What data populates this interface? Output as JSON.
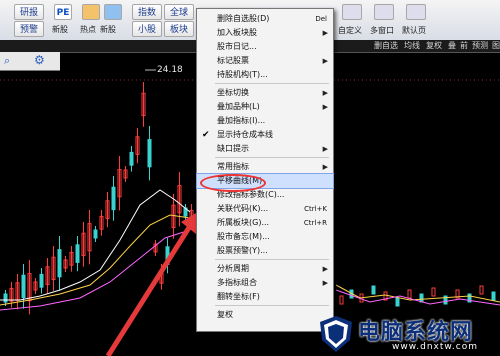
{
  "toolbar": {
    "left_labels": [
      "研报",
      "预警",
      "新股",
      "热点",
      "新股"
    ],
    "pe_badge": "PE",
    "buttons": [
      "指数",
      "全球",
      "小股",
      "板块"
    ],
    "right_labels": [
      "自定义",
      "多窗口",
      "默认页"
    ]
  },
  "subtoolbar": {
    "items": [
      "删自选",
      "均线",
      "复权",
      "叠",
      "前",
      "预测",
      "图"
    ]
  },
  "chart": {
    "peak_label": "24.18",
    "colors": {
      "up": "#ff3b3b",
      "down": "#3ad1d1",
      "ma1": "#ffffff",
      "ma2": "#ffd24a",
      "ma3": "#ff66ff"
    }
  },
  "context_menu": {
    "items": [
      {
        "label": "删除自选股(D)",
        "shortcut": "Del"
      },
      {
        "label": "加入板块股",
        "submenu": true
      },
      {
        "label": "股市日记..."
      },
      {
        "label": "标记股票",
        "submenu": true
      },
      {
        "label": "持股机构(T)..."
      },
      {
        "sep": true
      },
      {
        "label": "坐标切换",
        "submenu": true
      },
      {
        "label": "叠加品种(L)",
        "submenu": true
      },
      {
        "label": "叠加指标(I)..."
      },
      {
        "label": "显示持仓成本线",
        "checked": true
      },
      {
        "label": "缺口提示",
        "submenu": true
      },
      {
        "sep": true
      },
      {
        "label": "常用指标",
        "submenu": true
      },
      {
        "label": "平移曲线(M)",
        "highlighted": true
      },
      {
        "label": "修改指标参数(C)..."
      },
      {
        "label": "关联代码(K)...",
        "shortcut": "Ctrl+K"
      },
      {
        "label": "所属板块(G)...",
        "shortcut": "Ctrl+R"
      },
      {
        "label": "股市备忘(M)..."
      },
      {
        "label": "股票预警(Y)..."
      },
      {
        "sep": true
      },
      {
        "label": "分析周期",
        "submenu": true
      },
      {
        "label": "多指标组合",
        "submenu": true
      },
      {
        "label": "翻转坐标(F)"
      },
      {
        "sep": true
      },
      {
        "label": "复权"
      }
    ]
  },
  "watermark": {
    "title": "电脑系统网",
    "url": "www.dnxtw.com"
  }
}
